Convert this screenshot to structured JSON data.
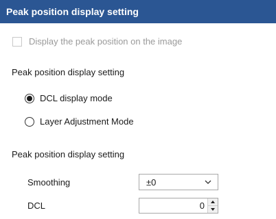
{
  "title": "Peak position display setting",
  "display_checkbox": {
    "label": "Display the peak position on the image",
    "checked": false,
    "enabled": false
  },
  "section1": {
    "heading": "Peak position display setting",
    "options": [
      {
        "label": "DCL display mode",
        "selected": true
      },
      {
        "label": "Layer Adjustment Mode",
        "selected": false
      }
    ]
  },
  "section2": {
    "heading": "Peak position display setting",
    "smoothing": {
      "label": "Smoothing",
      "value": "±0"
    },
    "dcl": {
      "label": "DCL",
      "value": "0"
    }
  }
}
